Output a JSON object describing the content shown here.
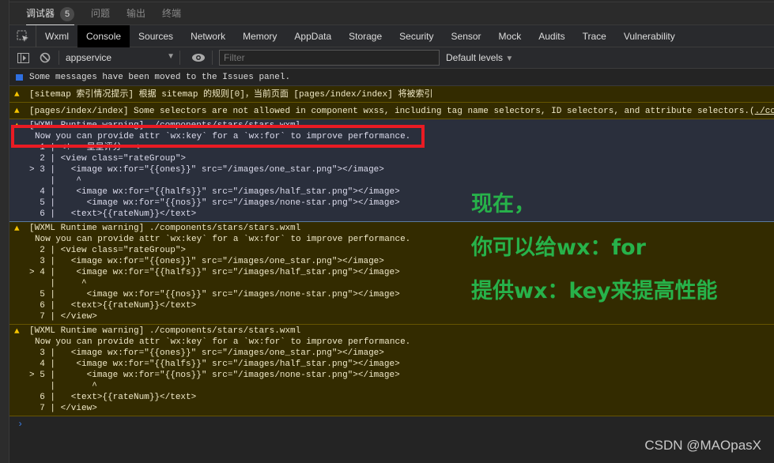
{
  "bottom_tabs": [
    {
      "label": "调试器",
      "badge": "5",
      "active": true
    },
    {
      "label": "问题"
    },
    {
      "label": "输出"
    },
    {
      "label": "终端"
    }
  ],
  "devtools_tabs": [
    "Wxml",
    "Console",
    "Sources",
    "Network",
    "Memory",
    "AppData",
    "Storage",
    "Security",
    "Sensor",
    "Mock",
    "Audits",
    "Trace",
    "Vulnerability"
  ],
  "active_tab": "Console",
  "toolbar": {
    "context": "appservice",
    "filter_placeholder": "Filter",
    "levels": "Default levels"
  },
  "messages": {
    "info": "Some messages have been moved to the Issues panel.",
    "sitemap": "[sitemap 索引情况提示] 根据 sitemap 的规则[0]，当前页面 [pages/index/index] 将被索引",
    "selectors": "[pages/index/index] Some selectors are not allowed in component wxss, including tag name selectors, ID selectors, and attribute selectors.(",
    "selectors_link": "./components/stars/stars.wxss"
  },
  "blocks": [
    {
      "title": "[WXML Runtime warning] ./components/stars/stars.wxml",
      "message": "Now you can provide attr `wx:key` for a `wx:for` to improve performance.",
      "lines": [
        "  1 | <!-- 星星评分 -->",
        "  2 | <view class=\"rateGroup\">",
        "> 3 |   <image wx:for=\"{{ones}}\" src=\"/images/one_star.png\"></image>",
        "    |    ^",
        "  4 |    <image wx:for=\"{{halfs}}\" src=\"/images/half_star.png\"></image>",
        "  5 |      <image wx:for=\"{{nos}}\" src=\"/images/none-star.png\"></image>",
        "  6 |   <text>{{rateNum}}</text>"
      ]
    },
    {
      "title": "[WXML Runtime warning] ./components/stars/stars.wxml",
      "message": "Now you can provide attr `wx:key` for a `wx:for` to improve performance.",
      "lines": [
        "  2 | <view class=\"rateGroup\">",
        "  3 |   <image wx:for=\"{{ones}}\" src=\"/images/one_star.png\"></image>",
        "> 4 |    <image wx:for=\"{{halfs}}\" src=\"/images/half_star.png\"></image>",
        "    |     ^",
        "  5 |      <image wx:for=\"{{nos}}\" src=\"/images/none-star.png\"></image>",
        "  6 |   <text>{{rateNum}}</text>",
        "  7 | </view>"
      ]
    },
    {
      "title": "[WXML Runtime warning] ./components/stars/stars.wxml",
      "message": "Now you can provide attr `wx:key` for a `wx:for` to improve performance.",
      "lines": [
        "  3 |   <image wx:for=\"{{ones}}\" src=\"/images/one_star.png\"></image>",
        "  4 |    <image wx:for=\"{{halfs}}\" src=\"/images/half_star.png\"></image>",
        "> 5 |      <image wx:for=\"{{nos}}\" src=\"/images/none-star.png\"></image>",
        "    |       ^",
        "  6 |   <text>{{rateNum}}</text>",
        "  7 | </view>"
      ]
    }
  ],
  "prompt": "›",
  "annotation": [
    "现在，",
    "你可以给wx：for",
    "提供wx：key来提高性能"
  ],
  "watermark": "CSDN @MAOpasX",
  "colors": {
    "annotation": "#27b24a",
    "highlight_box": "#ea1b23",
    "warning_bg": "#332b00",
    "selected_bg": "#2a2f3c"
  }
}
